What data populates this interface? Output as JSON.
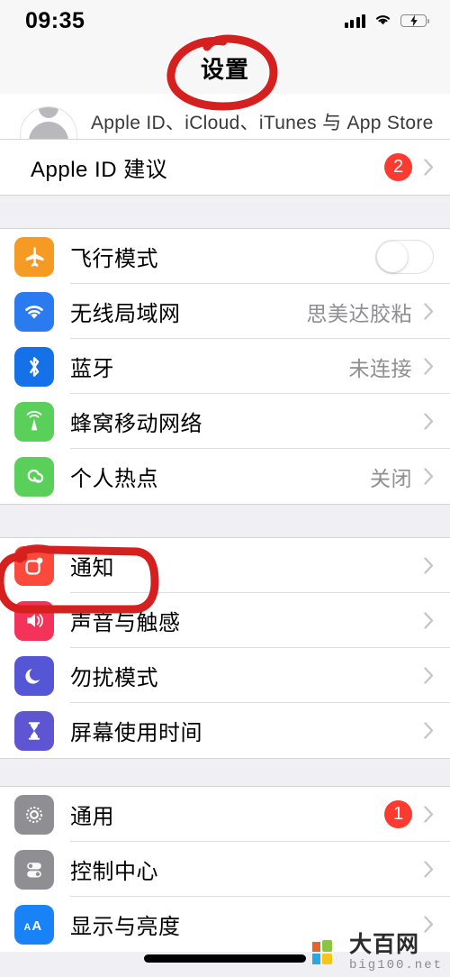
{
  "status_bar": {
    "time": "09:35",
    "signal_icon": "cellular-signal-icon",
    "wifi_icon": "wifi-icon",
    "battery_icon": "battery-charging-icon",
    "battery_level_percent": 28,
    "battery_charging": true
  },
  "nav": {
    "title": "设置"
  },
  "account": {
    "avatar_icon": "avatar-placeholder-icon",
    "subtitle": "Apple ID、iCloud、iTunes 与 App Store"
  },
  "sections": [
    {
      "name": "apple-id-suggestions",
      "rows": [
        {
          "label": "Apple ID 建议",
          "icon": "none",
          "icon_color": "",
          "badge": "2",
          "value": "",
          "accessory": "chevron"
        }
      ]
    },
    {
      "name": "connectivity",
      "rows": [
        {
          "label": "飞行模式",
          "icon": "airplane-icon",
          "icon_color": "#f59a23",
          "badge": "",
          "value": "",
          "accessory": "toggle-off"
        },
        {
          "label": "无线局域网",
          "icon": "wifi-icon",
          "icon_color": "#2a7bf0",
          "badge": "",
          "value": "思美达胶粘",
          "accessory": "chevron"
        },
        {
          "label": "蓝牙",
          "icon": "bluetooth-icon",
          "icon_color": "#1571e8",
          "badge": "",
          "value": "未连接",
          "accessory": "chevron"
        },
        {
          "label": "蜂窝移动网络",
          "icon": "cellular-icon",
          "icon_color": "#5ad05a",
          "badge": "",
          "value": "",
          "accessory": "chevron"
        },
        {
          "label": "个人热点",
          "icon": "personal-hotspot-icon",
          "icon_color": "#5ad05a",
          "badge": "",
          "value": "关闭",
          "accessory": "chevron"
        }
      ]
    },
    {
      "name": "notifications-sounds",
      "rows": [
        {
          "label": "通知",
          "icon": "notifications-icon",
          "icon_color": "#fa4a3c",
          "badge": "",
          "value": "",
          "accessory": "chevron"
        },
        {
          "label": "声音与触感",
          "icon": "sounds-haptics-icon",
          "icon_color": "#f4335a",
          "badge": "",
          "value": "",
          "accessory": "chevron"
        },
        {
          "label": "勿扰模式",
          "icon": "do-not-disturb-moon-icon",
          "icon_color": "#5456d6",
          "badge": "",
          "value": "",
          "accessory": "chevron"
        },
        {
          "label": "屏幕使用时间",
          "icon": "screen-time-hourglass-icon",
          "icon_color": "#5d55d2",
          "badge": "",
          "value": "",
          "accessory": "chevron"
        }
      ]
    },
    {
      "name": "system",
      "rows": [
        {
          "label": "通用",
          "icon": "gear-icon",
          "icon_color": "#8e8e93",
          "badge": "1",
          "value": "",
          "accessory": "chevron"
        },
        {
          "label": "控制中心",
          "icon": "control-center-icon",
          "icon_color": "#8e8e93",
          "badge": "",
          "value": "",
          "accessory": "chevron"
        },
        {
          "label": "显示与亮度",
          "icon": "display-brightness-aa-icon",
          "icon_color": "#1a82f7",
          "badge": "",
          "value": "",
          "accessory": "chevron"
        }
      ]
    }
  ],
  "annotations": [
    {
      "name": "red-circle-around-title",
      "shape": "ellipse",
      "color": "#d61f1f",
      "target": "设置"
    },
    {
      "name": "red-rectangle-around-notifications",
      "shape": "rounded-rect",
      "color": "#d61f1f",
      "target": "通知"
    }
  ],
  "colors": {
    "badge_red": "#fc3b30",
    "annotation_red": "#d61f1f",
    "value_gray": "#8e8e93",
    "section_bg": "#efeff4",
    "row_bg": "#ffffff",
    "battery_green": "#4cd264"
  },
  "watermark": {
    "title": "大百网",
    "domain": "big100.net",
    "logo_icon": "big100-logo-icon"
  },
  "home_indicator": {
    "name": "home-indicator-bar"
  }
}
